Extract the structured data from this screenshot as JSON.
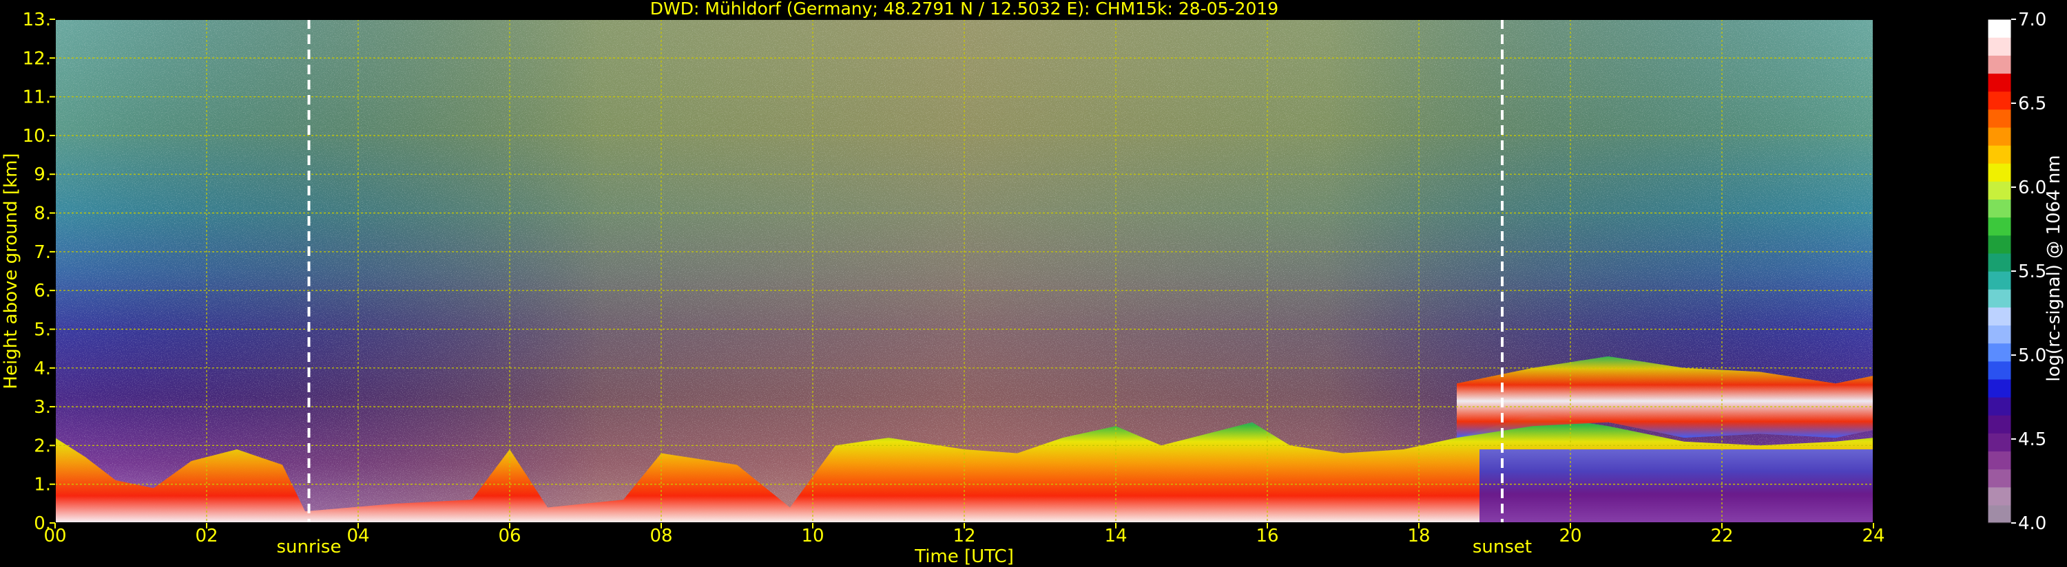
{
  "chart_data": {
    "type": "heatmap",
    "title": "DWD: Mühldorf (Germany; 48.2791 N / 12.5032 E):    CHM15k: 28-05-2019",
    "xlabel": "Time [UTC]",
    "ylabel": "Height above ground [km]",
    "x_range": [
      0,
      24
    ],
    "y_range": [
      0,
      13
    ],
    "x_ticks": [
      0,
      2,
      4,
      6,
      8,
      10,
      12,
      14,
      16,
      18,
      20,
      22,
      24
    ],
    "x_tick_labels": [
      "00",
      "02",
      "04",
      "06",
      "08",
      "10",
      "12",
      "14",
      "16",
      "18",
      "20",
      "22",
      "24"
    ],
    "y_ticks": [
      0,
      1,
      2,
      3,
      4,
      5,
      6,
      7,
      8,
      9,
      10,
      11,
      12,
      13
    ],
    "y_tick_labels": [
      "0.",
      "1.",
      "2.",
      "3.",
      "4.",
      "5.",
      "6.",
      "7.",
      "8.",
      "9.",
      "10.",
      "11.",
      "12.",
      "13."
    ],
    "grid": true,
    "markers": [
      {
        "label": "sunrise",
        "time_utc": 3.35
      },
      {
        "label": "sunset",
        "time_utc": 19.1
      }
    ],
    "colorbar": {
      "label": "log(rc-signal) @ 1064 nm",
      "range": [
        4.0,
        7.0
      ],
      "ticks": [
        4.0,
        4.5,
        5.0,
        5.5,
        6.0,
        6.5,
        7.0
      ],
      "tick_labels": [
        "4.0",
        "4.5",
        "5.0",
        "5.5",
        "6.0",
        "6.5",
        "7.0"
      ],
      "colors": [
        "#a08ca6",
        "#b18cb0",
        "#9c5aa0",
        "#8a3c96",
        "#6a1f8c",
        "#55108a",
        "#3a0fa0",
        "#1a1ad8",
        "#2a52f0",
        "#5a8cff",
        "#96b8ff",
        "#bcd2ff",
        "#6ed2d2",
        "#2cb4a8",
        "#18a070",
        "#1ea03a",
        "#3cc83c",
        "#7ee05a",
        "#c8f03c",
        "#f0f000",
        "#ffc800",
        "#ff9600",
        "#ff6400",
        "#ff2800",
        "#e60000",
        "#f0a0a0",
        "#ffdede",
        "#ffffff"
      ]
    },
    "colors": {
      "text": "#ffff00",
      "background": "#000000",
      "grid": "#c8c800",
      "marker_line": "#ffffff",
      "colorbar_text": "#ffffff"
    },
    "features": [
      {
        "kind": "boundary_layer",
        "profile": [
          [
            0,
            2.2
          ],
          [
            0.4,
            1.7
          ],
          [
            0.8,
            1.1
          ],
          [
            1.3,
            0.9
          ],
          [
            1.8,
            1.6
          ],
          [
            2.4,
            1.9
          ],
          [
            3.0,
            1.5
          ],
          [
            3.3,
            0.3
          ],
          [
            4.5,
            0.5
          ],
          [
            5.5,
            0.6
          ],
          [
            6.0,
            1.9
          ],
          [
            6.5,
            0.4
          ],
          [
            7.5,
            0.6
          ],
          [
            8.0,
            1.8
          ],
          [
            9.0,
            1.5
          ],
          [
            9.7,
            0.4
          ],
          [
            10.3,
            2.0
          ],
          [
            11.0,
            2.2
          ],
          [
            12.0,
            1.9
          ],
          [
            12.7,
            1.8
          ],
          [
            13.3,
            2.2
          ],
          [
            14.0,
            2.5
          ],
          [
            14.6,
            2.0
          ],
          [
            15.2,
            2.3
          ],
          [
            15.8,
            2.6
          ],
          [
            16.3,
            2.0
          ],
          [
            17.0,
            1.8
          ],
          [
            17.8,
            1.9
          ],
          [
            18.5,
            2.2
          ],
          [
            19.5,
            2.8
          ],
          [
            20.5,
            2.5
          ],
          [
            21.5,
            2.1
          ],
          [
            22.5,
            2.0
          ],
          [
            23.5,
            2.1
          ],
          [
            24.0,
            2.2
          ]
        ],
        "value": 6.4
      },
      {
        "kind": "elevated_aerosol_layer",
        "profile_low": [
          [
            18.5,
            2.2
          ],
          [
            19.5,
            2.5
          ],
          [
            20.5,
            2.6
          ],
          [
            21.5,
            2.2
          ],
          [
            22.5,
            2.3
          ],
          [
            23.5,
            2.2
          ],
          [
            24,
            2.4
          ]
        ],
        "profile_high": [
          [
            18.5,
            3.6
          ],
          [
            19.5,
            4.0
          ],
          [
            20.5,
            4.3
          ],
          [
            21.5,
            4.0
          ],
          [
            22.5,
            3.9
          ],
          [
            23.5,
            3.6
          ],
          [
            24,
            3.8
          ]
        ],
        "value": 6.6
      },
      {
        "kind": "residual_layer",
        "time_start": 18.8,
        "time_end": 24.0,
        "height_top": 1.9,
        "value": 5.0
      }
    ]
  }
}
